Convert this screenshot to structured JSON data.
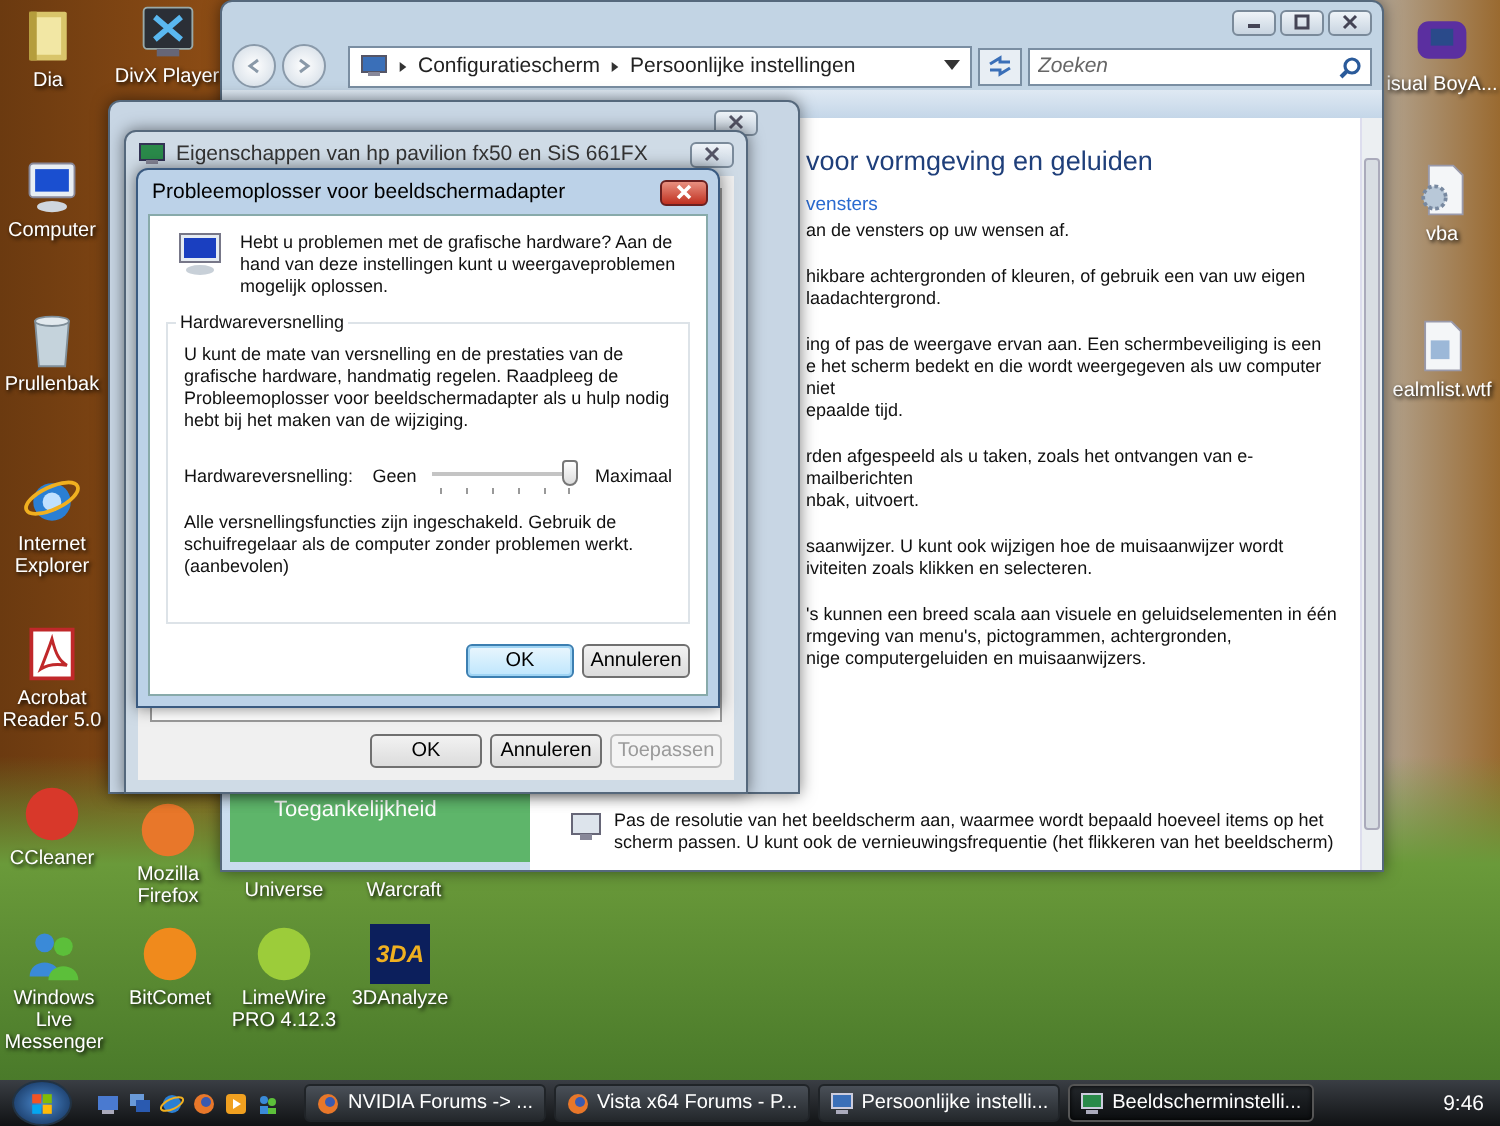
{
  "desktop_icons": [
    {
      "label": "Dia",
      "kind": "folder"
    },
    {
      "label": "DivX Player",
      "kind": "player"
    },
    {
      "label": "Computer",
      "kind": "monitor"
    },
    {
      "label": "Prullenbak",
      "kind": "trash"
    },
    {
      "label": "Internet Explorer",
      "kind": "globe"
    },
    {
      "label": "Acrobat Reader 5.0",
      "kind": "pdf"
    },
    {
      "label": "CCleaner",
      "kind": "round",
      "color": "#d8382a"
    },
    {
      "label": "Mozilla Firefox",
      "kind": "round",
      "color": "#e8772a"
    },
    {
      "label": "Windows Live Messenger",
      "kind": "people"
    },
    {
      "label": "BitComet",
      "kind": "round",
      "color": "#f08a1c"
    },
    {
      "label": "Universe",
      "kind": "covered"
    },
    {
      "label": "Warcraft",
      "kind": "covered"
    },
    {
      "label": "LimeWire PRO 4.12.3",
      "kind": "round",
      "color": "#9ccc3a"
    },
    {
      "label": "3DAnalyze",
      "kind": "logo",
      "logo_text": "3DA"
    },
    {
      "label": "isual BoyA...",
      "kind": "console"
    },
    {
      "label": "vba",
      "kind": "settings_file"
    },
    {
      "label": "ealmlist.wtf",
      "kind": "file"
    }
  ],
  "control_panel": {
    "breadcrumb": [
      "Configuratiescherm",
      "Persoonlijke instellingen"
    ],
    "search_placeholder": "Zoeken",
    "heading": "voor vormgeving en geluiden",
    "link": "vensters",
    "sections": [
      [
        "an de vensters op uw wensen af."
      ],
      [
        "hikbare achtergronden of kleuren, of gebruik een van uw eigen",
        "laadachtergrond."
      ],
      [
        "ing of pas de weergave ervan aan. Een schermbeveiliging is een",
        "e het scherm bedekt en die wordt weergegeven als uw computer niet",
        "epaalde tijd."
      ],
      [
        "rden afgespeeld als u taken, zoals het ontvangen van e-mailberichten",
        "nbak, uitvoert."
      ],
      [
        "saanwijzer. U kunt ook wijzigen hoe de muisaanwijzer wordt",
        "iviteiten zoals klikken en selecteren."
      ],
      [
        "'s kunnen een breed scala aan visuele en geluidselementen in één",
        "rmgeving van menu's, pictogrammen, achtergronden,",
        "nige computergeluiden en muisaanwijzers."
      ]
    ],
    "last_section": "Pas de resolutie van het beeldscherm aan, waarmee wordt bepaald hoeveel items op het scherm passen. U kunt ook de vernieuwingsfrequentie (het flikkeren van het beeldscherm)",
    "sidebar_item": "Toegankelijkheid"
  },
  "properties_window": {
    "title": "Eigenschappen van hp pavilion fx50 en SiS 661FX",
    "buttons": [
      {
        "label": "OK",
        "disabled": false
      },
      {
        "label": "Annuleren",
        "disabled": false
      },
      {
        "label": "Toepassen",
        "disabled": true
      }
    ]
  },
  "troubleshooter": {
    "title": "Probleemoplosser voor beeldschermadapter",
    "intro": "Hebt u problemen met de grafische hardware? Aan de hand van deze instellingen kunt u weergaveproblemen mogelijk oplossen.",
    "group_title": "Hardwareversnelling",
    "description": "U kunt de mate van versnelling en de prestaties van de grafische hardware, handmatig regelen. Raadpleeg de Probleemoplosser voor beeldschermadapter als u hulp nodig hebt bij het maken van de wijziging.",
    "slider": {
      "label": "Hardwareversnelling:",
      "min_label": "Geen",
      "max_label": "Maximaal",
      "level": 1
    },
    "status": "Alle versnellingsfuncties zijn ingeschakeld. Gebruik de schuifregelaar als de computer zonder problemen werkt. (aanbevolen)",
    "buttons": [
      {
        "label": "OK",
        "focused": true
      },
      {
        "label": "Annuleren",
        "focused": false
      }
    ]
  },
  "taskbar": {
    "tasks": [
      {
        "label": "NVIDIA Forums -> ...",
        "kind": "browser",
        "selected": false
      },
      {
        "label": "Vista x64 Forums - P...",
        "kind": "browser",
        "selected": false
      },
      {
        "label": "Persoonlijke instelli...",
        "kind": "control_panel",
        "selected": false
      },
      {
        "label": "Beeldscherminstelli...",
        "kind": "display",
        "selected": true
      }
    ],
    "clock": "9:46"
  }
}
